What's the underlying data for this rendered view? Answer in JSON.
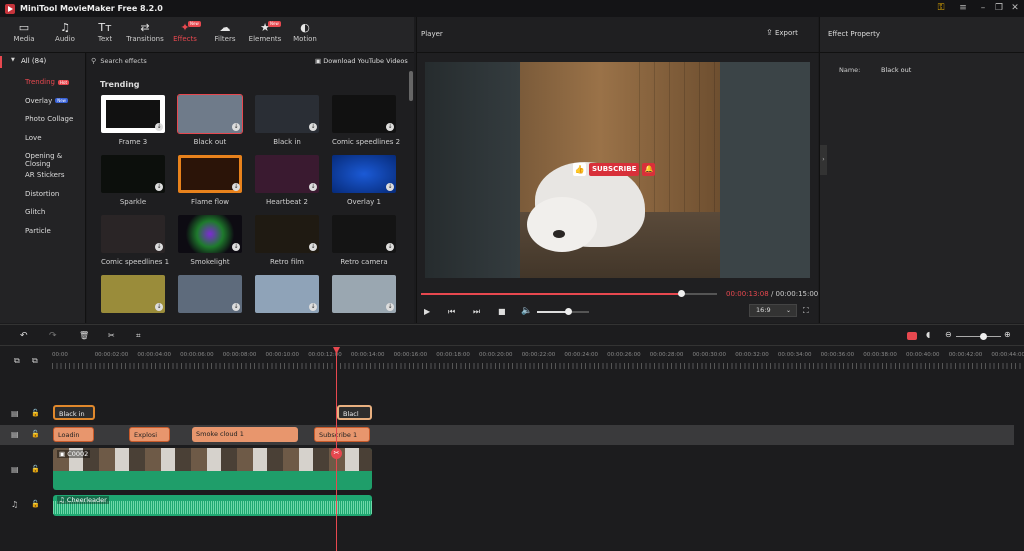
{
  "app": {
    "title": "MiniTool MovieMaker Free 8.2.0"
  },
  "toolbar": {
    "tabs": [
      {
        "label": "Media",
        "icon": "media-icon",
        "glyph": "▭"
      },
      {
        "label": "Audio",
        "icon": "music-note-icon",
        "glyph": "♫"
      },
      {
        "label": "Text",
        "icon": "text-icon",
        "glyph": "Tт"
      },
      {
        "label": "Transitions",
        "icon": "transitions-icon",
        "glyph": "⇄"
      },
      {
        "label": "Effects",
        "icon": "effects-icon",
        "glyph": "✦"
      },
      {
        "label": "Filters",
        "icon": "filters-icon",
        "glyph": "☁"
      },
      {
        "label": "Elements",
        "icon": "elements-icon",
        "glyph": "★"
      },
      {
        "label": "Motion",
        "icon": "motion-icon",
        "glyph": "◐"
      }
    ],
    "new_badge": "New"
  },
  "sidebar": {
    "all_label": "All (84)",
    "items": [
      {
        "label": "Trending",
        "tag": "Hot"
      },
      {
        "label": "Overlay",
        "tag": "New"
      },
      {
        "label": "Photo Collage"
      },
      {
        "label": "Love"
      },
      {
        "label": "Opening & Closing"
      },
      {
        "label": "AR Stickers"
      },
      {
        "label": "Distortion"
      },
      {
        "label": "Glitch"
      },
      {
        "label": "Particle"
      }
    ]
  },
  "effects": {
    "search_placeholder": "Search effects",
    "download_label": "Download YouTube Videos",
    "section": "Trending",
    "items": [
      {
        "name": "Frame 3",
        "color": "#f0f0f0"
      },
      {
        "name": "Black out",
        "color": "#6f7b8a"
      },
      {
        "name": "Black in",
        "color": "#2a2e35"
      },
      {
        "name": "Comic speedlines 2",
        "color": "#111"
      },
      {
        "name": "Sparkle",
        "color": "#0c0f0c"
      },
      {
        "name": "Flame flow",
        "color": "#2b1408"
      },
      {
        "name": "Heartbeat 2",
        "color": "#3a1a30"
      },
      {
        "name": "Overlay 1",
        "color": "#0b3fa8"
      },
      {
        "name": "Comic speedlines 1",
        "color": "#2a2526"
      },
      {
        "name": "Smokelight",
        "color": "#0d0b12"
      },
      {
        "name": "Retro film",
        "color": "#1f1a12"
      },
      {
        "name": "Retro camera",
        "color": "#141414"
      },
      {
        "name": "",
        "color": "#9a8c3a"
      },
      {
        "name": "",
        "color": "#5e6b7c"
      },
      {
        "name": "",
        "color": "#8fa3b8"
      },
      {
        "name": "",
        "color": "#9aa7b1"
      }
    ]
  },
  "player": {
    "title": "Player",
    "export_label": "Export",
    "subscribe": "SUBSCRIBE",
    "time_current": "00:00:13:08",
    "time_sep": " / ",
    "time_total": "00:00:15:00",
    "aspect": "16:9",
    "progress": 0.88,
    "volume": 0.6
  },
  "property": {
    "title": "Effect Property",
    "name_label": "Name:",
    "name_value": "Black out"
  },
  "timeline": {
    "ruler": [
      "00:00",
      "00:00:02:00",
      "00:00:04:00",
      "00:00:06:00",
      "00:00:08:00",
      "00:00:10:00",
      "00:00:12:00",
      "00:00:14:00",
      "00:00:16:00",
      "00:00:18:00",
      "00:00:20:00",
      "00:00:22:00",
      "00:00:24:00",
      "00:00:26:00",
      "00:00:28:00",
      "00:00:30:00",
      "00:00:32:00",
      "00:00:34:00",
      "00:00:36:00",
      "00:00:38:00",
      "00:00:40:00",
      "00:00:42:00",
      "00:00:44:00"
    ],
    "effect_clips": [
      "Black in",
      "Blacl"
    ],
    "element_clips": [
      "Loadin",
      "Explosi",
      "Smoke cloud 1",
      "Subscribe 1"
    ],
    "video_clip": "C0002",
    "audio_clip": "Cheerleader"
  },
  "colors": {
    "accent": "#e7484f",
    "clip_orange": "#e8966d",
    "video_green": "#1f9e6a",
    "audio_green": "#1fa872"
  }
}
